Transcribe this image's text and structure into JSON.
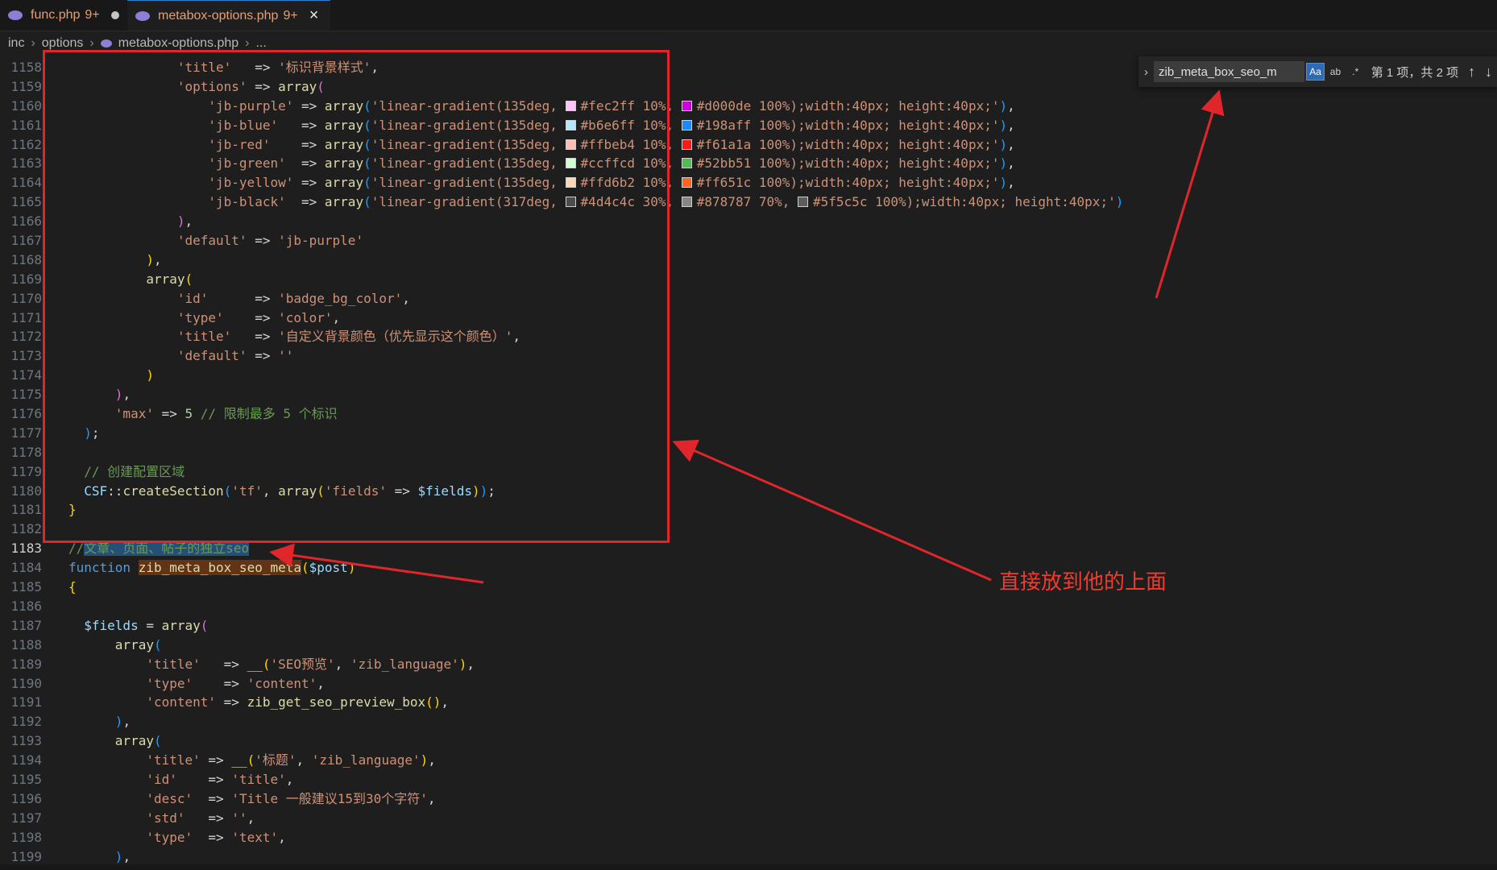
{
  "tabs": [
    {
      "label": "func.php",
      "badge": "9+",
      "icon": "php-elephant-icon"
    },
    {
      "label": "metabox-options.php",
      "badge": "9+",
      "icon": "php-elephant-icon"
    }
  ],
  "breadcrumb": [
    "inc",
    "options",
    "metabox-options.php",
    "..."
  ],
  "find": {
    "query": "zib_meta_box_seo_m",
    "match_case": "Aa",
    "whole_word": "ab",
    "regex": ".*",
    "count": "第 1 项，共 2 项"
  },
  "line_numbers": [
    "1158",
    "1159",
    "1160",
    "1161",
    "1162",
    "1163",
    "1164",
    "1165",
    "1166",
    "1167",
    "1168",
    "1169",
    "1170",
    "1171",
    "1172",
    "1173",
    "1174",
    "1175",
    "1176",
    "1177",
    "1178",
    "1179",
    "1180",
    "1181",
    "1182",
    "1183",
    "1184",
    "1185",
    "1186",
    "1187",
    "1188",
    "1189",
    "1190",
    "1191",
    "1192",
    "1193",
    "1194",
    "1195",
    "1196",
    "1197",
    "1198",
    "1199"
  ],
  "code": {
    "l1158_key": "'title'",
    "l1158_val": "'标识背景样式'",
    "l1159_key": "'options'",
    "l1160_key": "'jb-purple'",
    "l1160_c1": "#fec2ff",
    "l1160_c2": "#d000de",
    "l1160_rest": " 100%);width:40px; height:40px;'",
    "l1161_key": "'jb-blue'  ",
    "l1161_c1": "#b6e6ff",
    "l1161_c2": "#198aff",
    "l1161_rest": " 100%);width:40px; height:40px;'",
    "l1162_key": "'jb-red'   ",
    "l1162_c1": "#ffbeb4",
    "l1162_c2": "#f61a1a",
    "l1162_rest": " 100%);width:40px; height:40px;'",
    "l1163_key": "'jb-green' ",
    "l1163_c1": "#ccffcd",
    "l1163_c2": "#52bb51",
    "l1163_rest": " 100%);width:40px; height:40px;'",
    "l1164_key": "'jb-yellow'",
    "l1164_c1": "#ffd6b2",
    "l1164_c2": "#ff651c",
    "l1164_rest": " 100%);width:40px; height:40px;'",
    "l1165_key": "'jb-black' ",
    "l1165_c1": "#4d4c4c",
    "l1165_c2": "#878787",
    "l1165_c3": "#5f5c5c",
    "l1165_rest": " 100%);width:40px; height:40px;'",
    "grad135": "'linear-gradient(135deg,",
    "grad317": "'linear-gradient(317deg,",
    "l1167_key": "'default'",
    "l1167_val": "'jb-purple'",
    "l1170_key": "'id'     ",
    "l1170_val": "'badge_bg_color'",
    "l1171_key": "'type'   ",
    "l1171_val": "'color'",
    "l1172_key": "'title'  ",
    "l1172_val": "'自定义背景颜色（优先显示这个颜色）'",
    "l1173_key": "'default'",
    "l1173_val": "''",
    "l1176_key": "'max'",
    "l1176_num": "5",
    "l1176_comment": "// 限制最多 5 个标识",
    "l1179_comment": "// 创建配置区域",
    "l1180_class": "CSF",
    "l1180_fn": "createSection",
    "l1180_arg1": "'tf'",
    "l1180_key": "'fields'",
    "l1180_var": "$fields",
    "l1183_slashes": "//",
    "l1183_comment": "文章、页面、帖子的独立seo",
    "l1184_kw": "function",
    "l1184_fn": "zib_meta_box_seo_meta",
    "l1184_var": "$post",
    "l1187_var": "$fields",
    "l1189_key": "'title'  ",
    "l1189_val": "'SEO预览'",
    "l1189_lang": "'zib_language'",
    "l1190_key": "'type'   ",
    "l1190_val": "'content'",
    "l1191_key": "'content'",
    "l1191_fn": "zib_get_seo_preview_box",
    "l1194_key": "'title'",
    "l1194_val": "'标题'",
    "l1194_lang": "'zib_language'",
    "l1195_key": "'id'   ",
    "l1195_val": "'title'",
    "l1196_key": "'desc' ",
    "l1196_val": "'Title 一般建议15到30个字符'",
    "l1197_key": "'std'  ",
    "l1197_val": "''",
    "l1198_key": "'type' ",
    "l1198_val": "'text'",
    "arrow": "=>",
    "array": "array"
  },
  "annotation": {
    "text": "直接放到他的上面",
    "color": "#e0262b"
  },
  "colors": {
    "background": "#1e1e1e",
    "string": "#ce9178",
    "keyword": "#569cd6",
    "function": "#dcdcaa",
    "variable": "#9cdcfe",
    "comment": "#6a9955",
    "number": "#b5cea8"
  }
}
